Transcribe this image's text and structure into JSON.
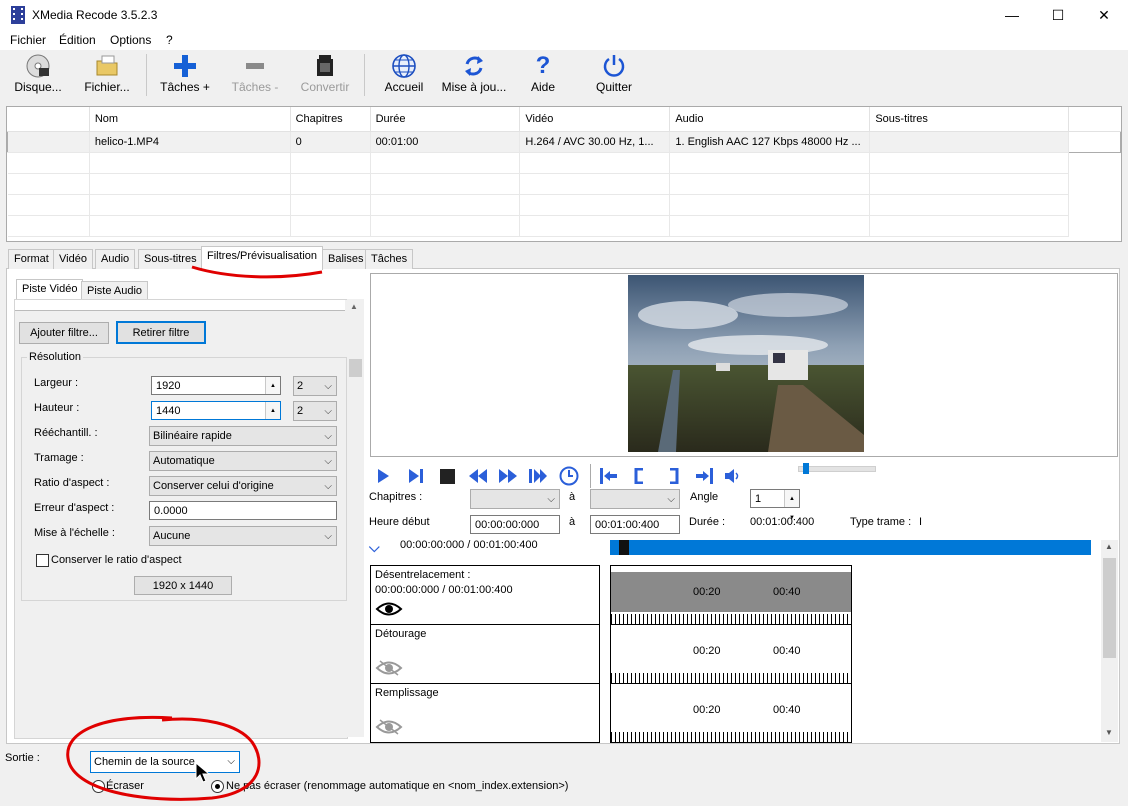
{
  "window": {
    "title": "XMedia Recode 3.5.2.3",
    "min": "—",
    "max": "☐",
    "close": "✕"
  },
  "menu": [
    "Fichier",
    "Édition",
    "Options",
    "?"
  ],
  "toolbar": [
    {
      "label": "Disque...",
      "icon": "disc-icon",
      "enabled": true
    },
    {
      "label": "Fichier...",
      "icon": "open-file-icon",
      "enabled": true
    },
    {
      "label": "Tâches +",
      "icon": "plus-icon",
      "enabled": true
    },
    {
      "label": "Tâches -",
      "icon": "minus-icon",
      "enabled": false
    },
    {
      "label": "Convertir",
      "icon": "film-icon",
      "enabled": false
    },
    {
      "label": "Accueil",
      "icon": "globe-icon",
      "enabled": true
    },
    {
      "label": "Mise à jou...",
      "icon": "refresh-icon",
      "enabled": true
    },
    {
      "label": "Aide",
      "icon": "help-icon",
      "enabled": true
    },
    {
      "label": "Quitter",
      "icon": "power-icon",
      "enabled": true
    }
  ],
  "file_table": {
    "columns": [
      "",
      "Nom",
      "Chapitres",
      "Durée",
      "Vidéo",
      "Audio",
      "Sous-titres"
    ],
    "rows": [
      [
        "",
        "helico-1.MP4",
        "0",
        "00:01:00",
        "H.264 / AVC  30.00 Hz, 1...",
        "1. English AAC  127 Kbps 48000 Hz ...",
        ""
      ]
    ]
  },
  "tabs": [
    "Format",
    "Vidéo",
    "Audio",
    "Sous-titres",
    "Filtres/Prévisualisation",
    "Balises",
    "Tâches"
  ],
  "active_tab": "Filtres/Prévisualisation",
  "subtabs": [
    "Piste Vidéo",
    "Piste Audio"
  ],
  "filter_buttons": {
    "add": "Ajouter filtre...",
    "remove": "Retirer filtre"
  },
  "resolution": {
    "group": "Résolution",
    "width_label": "Largeur :",
    "width": "1920",
    "width_div": "2",
    "height_label": "Hauteur :",
    "height": "1440",
    "height_div": "2",
    "resample_label": "Rééchantill. :",
    "resample": "Bilinéaire rapide",
    "dither_label": "Tramage :",
    "dither": "Automatique",
    "aspect_label": "Ratio d'aspect :",
    "aspect": "Conserver celui d'origine",
    "aspect_err_label": "Erreur d'aspect :",
    "aspect_err": "0.0000",
    "scale_label": "Mise à l'échelle :",
    "scale": "Aucune",
    "keep_aspect": "Conserver le ratio d'aspect",
    "keep_aspect_checked": false,
    "size_display": "1920 x 1440"
  },
  "player": {
    "chapters_label": "Chapitres :",
    "to1": "à",
    "to2": "à",
    "angle_label": "Angle",
    "angle": "1",
    "start_label": "Heure début",
    "start": "00:00:00:000",
    "end": "00:01:00:400",
    "duration_label": "Durée :",
    "duration": "00:01:00:400",
    "frame_type_label": "Type trame :",
    "frame_type": "I",
    "position": "00:00:00:000 / 00:01:00:400",
    "progress": 0.02,
    "volume": 0.05
  },
  "tracks": [
    {
      "name": "Désentrelacement :",
      "time": "00:00:00:000 / 00:01:00:400",
      "visible": true,
      "marks": [
        "00:20",
        "00:40"
      ]
    },
    {
      "name": "Détourage",
      "time": "",
      "visible": false,
      "marks": [
        "00:20",
        "00:40"
      ]
    },
    {
      "name": "Remplissage",
      "time": "",
      "visible": false,
      "marks": [
        "00:20",
        "00:40"
      ]
    }
  ],
  "output": {
    "label": "Sortie :",
    "value": "Chemin de la source",
    "overwrite": "Écraser",
    "no_overwrite": "Ne pas écraser (renommage automatique en <nom_index.extension>)",
    "selected": "no_overwrite"
  },
  "colors": {
    "accent": "#0078d7",
    "annotation": "#e00000",
    "ctl_blue": "#2b5fd9"
  }
}
